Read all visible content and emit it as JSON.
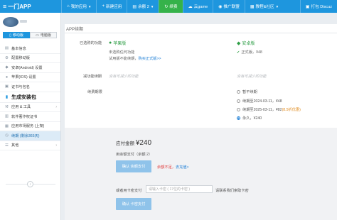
{
  "header": {
    "brand": "一门APP",
    "nav": [
      {
        "icon": "home-icon",
        "glyph": "⌂",
        "label": "我的应用",
        "caret": true
      },
      {
        "icon": "plus-icon",
        "glyph": "+",
        "label": "新建应用",
        "caret": false
      },
      {
        "icon": "doc-icon",
        "glyph": "▤",
        "label": "余额 2",
        "caret": true
      },
      {
        "icon": "refresh-icon",
        "glyph": "↻",
        "label": "续费",
        "caret": false,
        "active": true
      },
      {
        "icon": "cloud-icon",
        "glyph": "☁",
        "label": "云game",
        "caret": false
      },
      {
        "icon": "ad-icon",
        "glyph": "◉",
        "label": "推广联盟",
        "caret": false
      },
      {
        "icon": "book-icon",
        "glyph": "▦",
        "label": "教程&社区",
        "caret": true
      }
    ],
    "right_link": "打包 Discuz",
    "accent": "#1e96de",
    "active_color": "#35b24a"
  },
  "sidebar": {
    "tabs": [
      "移动版",
      "电脑版"
    ],
    "items": [
      {
        "icon": "info-icon",
        "glyph": "▤",
        "label": "基本信息"
      },
      {
        "icon": "settings-icon",
        "glyph": "⚙",
        "label": "配置移动版"
      },
      {
        "icon": "android-icon",
        "glyph": "◆",
        "label": "安卓(Android) 设置"
      },
      {
        "icon": "apple-icon",
        "glyph": "●",
        "label": "苹果(IOS) 设置"
      },
      {
        "icon": "cert-icon",
        "glyph": "▣",
        "label": "证书与包名"
      }
    ],
    "section": "生成安装包",
    "items2": [
      {
        "icon": "tools-icon",
        "glyph": "⚒",
        "label": "应用 & 工具",
        "chev": "›"
      },
      {
        "icon": "copyright-icon",
        "glyph": "▥",
        "label": "软件著作权证书"
      },
      {
        "icon": "market-icon",
        "glyph": "▦",
        "label": "应用市场服务 (上架)"
      },
      {
        "icon": "clock-icon",
        "glyph": "◷",
        "label": "续期 (剩余365天)",
        "active": true
      },
      {
        "icon": "other-icon",
        "glyph": "☰",
        "label": "其他",
        "chev": "›"
      }
    ],
    "collapse_glyph": "‹"
  },
  "main": {
    "title": "APP续期",
    "selected_label": "已选购的功能",
    "apple_name": "苹果版",
    "apple_line1": "未选购任何功能",
    "apple_line2_prefix": "试用版不能续期，",
    "apple_link": "购买正式版>>",
    "android_name": "安卓版",
    "android_feature": "正式版，¥48",
    "reduce_label": "减功能续期",
    "reduce_hint1": "没有可减少的功能",
    "reduce_hint2": "没有可减少的功能",
    "period_label": "续费期限",
    "options": [
      {
        "text": "暂不续期",
        "extra": "",
        "selected": false
      },
      {
        "text": "续期至2024-03-11，¥48",
        "extra": "",
        "selected": false
      },
      {
        "text": "续期至2025-03-11，¥82 ",
        "extra": "(8.5折优惠)",
        "selected": false
      },
      {
        "text": "永久，¥240",
        "extra": "",
        "selected": true
      }
    ],
    "due_label": "应付金额 ",
    "due_amount": "¥240",
    "balance_label": "用余额支付（余额 2）",
    "confirm_balance_btn": "确认 余额支付",
    "balance_warn": "余额不足，",
    "recharge_link": "去充值>",
    "code_label": "或者用卡密支付",
    "code_placeholder": "请输入卡密 ( 17位的卡密 )",
    "code_hint": "请联系我们索取卡密",
    "confirm_code_btn": "确认 卡密支付"
  }
}
